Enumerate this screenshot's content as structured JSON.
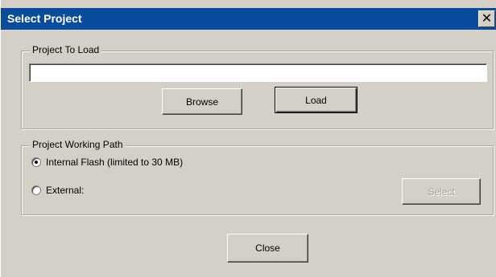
{
  "window": {
    "title": "Select Project",
    "close_glyph": "✕"
  },
  "project_to_load": {
    "legend": "Project To Load",
    "path_value": "",
    "browse_label": "Browse",
    "load_label": "Load"
  },
  "working_path": {
    "legend": "Project Working Path",
    "options": [
      {
        "label": "Internal Flash (limited to 30 MB)",
        "selected": true
      },
      {
        "label": "External:",
        "selected": false
      }
    ],
    "select_label": "Select"
  },
  "footer": {
    "close_label": "Close"
  },
  "colors": {
    "titlebar": "#0a4c9c",
    "dialog_bg": "#d4d0c8"
  }
}
